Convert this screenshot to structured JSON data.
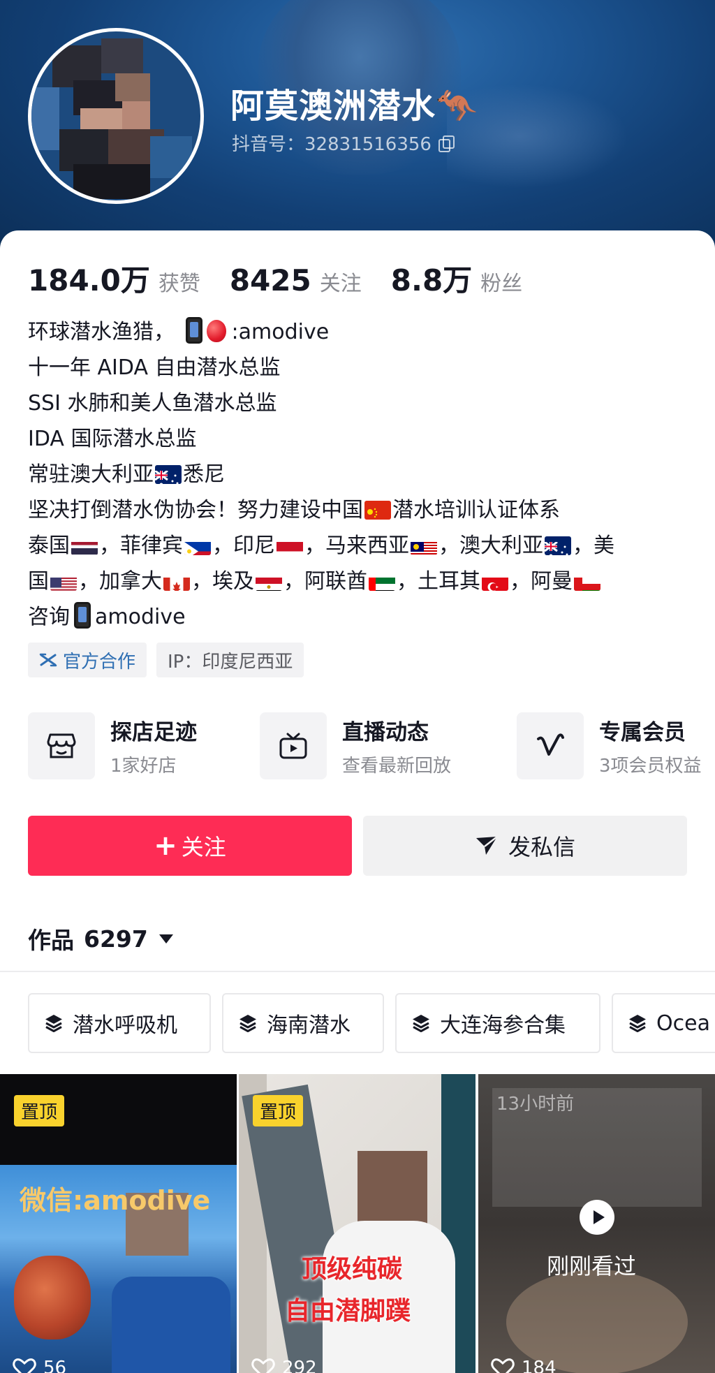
{
  "profile": {
    "nickname": "阿莫澳洲潜水🦘",
    "douyin_id": "抖音号：32831516356"
  },
  "stats": {
    "likes": {
      "value": "184.0万",
      "label": "获赞"
    },
    "following": {
      "value": "8425",
      "label": "关注"
    },
    "followers": {
      "value": "8.8万",
      "label": "粉丝"
    }
  },
  "bio": {
    "line1_text": "环球潜水渔猎，",
    "line1_id": ":amodive",
    "line2": "十一年 AIDA 自由潜水总监",
    "line3": "SSI 水肺和美人鱼潜水总监",
    "line4": "IDA 国际潜水总监",
    "line5_a": "常驻澳大利亚",
    "line5_b": "悉尼",
    "line6_a": "坚决打倒潜水伪协会！努力建设中国",
    "line6_b": "潜水培训认证体系",
    "line7": [
      "泰国",
      "，菲律宾",
      "，印尼",
      "，马来西亚",
      "，澳大利亚",
      "，美"
    ],
    "line8": [
      "国",
      "，加拿大",
      "，埃及",
      "，阿联酋",
      "，土耳其",
      "，阿曼"
    ],
    "line9_a": "咨询",
    "line9_b": "amodive"
  },
  "tags": {
    "official": "官方合作",
    "ip": "IP：印度尼西亚"
  },
  "features": [
    {
      "title": "探店足迹",
      "sub": "1家好店",
      "icon": "shop-icon"
    },
    {
      "title": "直播动态",
      "sub": "查看最新回放",
      "icon": "tv-icon"
    },
    {
      "title": "专属会员",
      "sub": "3项会员权益",
      "icon": "v-icon"
    }
  ],
  "actions": {
    "follow": "关注",
    "message": "发私信"
  },
  "works": {
    "label": "作品",
    "count": "6297"
  },
  "collections": [
    "潜水呼吸机",
    "海南潜水",
    "大连海参合集",
    "Ocea"
  ],
  "videos": [
    {
      "pinned": "置顶",
      "caption": "微信:amodive",
      "likes": "56"
    },
    {
      "pinned": "置顶",
      "caption1": "顶级纯碳",
      "caption2": "自由潜脚蹼",
      "likes": "292"
    },
    {
      "time_ago": "13小时前",
      "watched": "刚刚看过",
      "likes": "184"
    }
  ],
  "colors": {
    "accent": "#fe2c55",
    "pin": "#f9d22d",
    "official_blue": "#2f6fb3"
  }
}
